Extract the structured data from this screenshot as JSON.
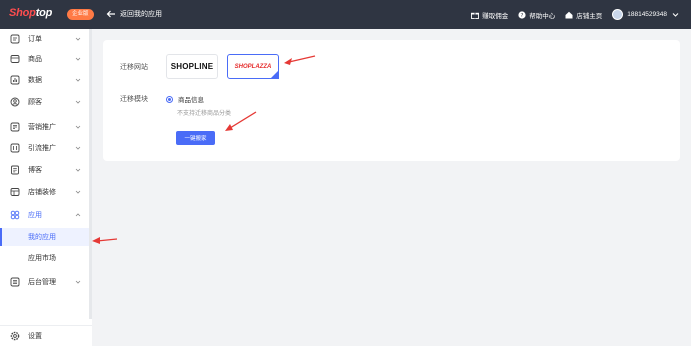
{
  "header": {
    "logo_part1": "Shop",
    "logo_part2": "top",
    "edition_badge": "企业版",
    "back_label": "返回我的应用",
    "links": [
      {
        "label": "赚取佣金",
        "icon": "gift-icon"
      },
      {
        "label": "帮助中心",
        "icon": "help-icon"
      },
      {
        "label": "店铺主页",
        "icon": "home-icon"
      }
    ],
    "account": "18814529348"
  },
  "sidebar": {
    "items": [
      {
        "label": "订单",
        "icon": "order-icon"
      },
      {
        "label": "商品",
        "icon": "product-icon"
      },
      {
        "label": "数据",
        "icon": "data-icon"
      },
      {
        "label": "顾客",
        "icon": "customer-icon"
      },
      {
        "label": "营销推广",
        "icon": "marketing-icon"
      },
      {
        "label": "引流推广",
        "icon": "traffic-icon"
      },
      {
        "label": "博客",
        "icon": "blog-icon"
      },
      {
        "label": "店铺装修",
        "icon": "store-design-icon"
      },
      {
        "label": "应用",
        "icon": "apps-icon"
      },
      {
        "label": "后台管理",
        "icon": "admin-icon"
      }
    ],
    "sub_items": [
      {
        "label": "我的应用"
      },
      {
        "label": "应用市场"
      }
    ],
    "settings_label": "设置"
  },
  "migration": {
    "site_label": "迁移网站",
    "sites": [
      {
        "label": "SHOPLINE"
      },
      {
        "label": "SHOPLAZZA"
      }
    ],
    "module_label": "迁移模块",
    "module_option": "商品信息",
    "module_hint": "不支持迁移商品分类",
    "button_label": "一键搬家"
  },
  "colors": {
    "topbar": "#2f3542",
    "accent": "#4a6cf7",
    "annotation_arrow": "#e53935"
  }
}
